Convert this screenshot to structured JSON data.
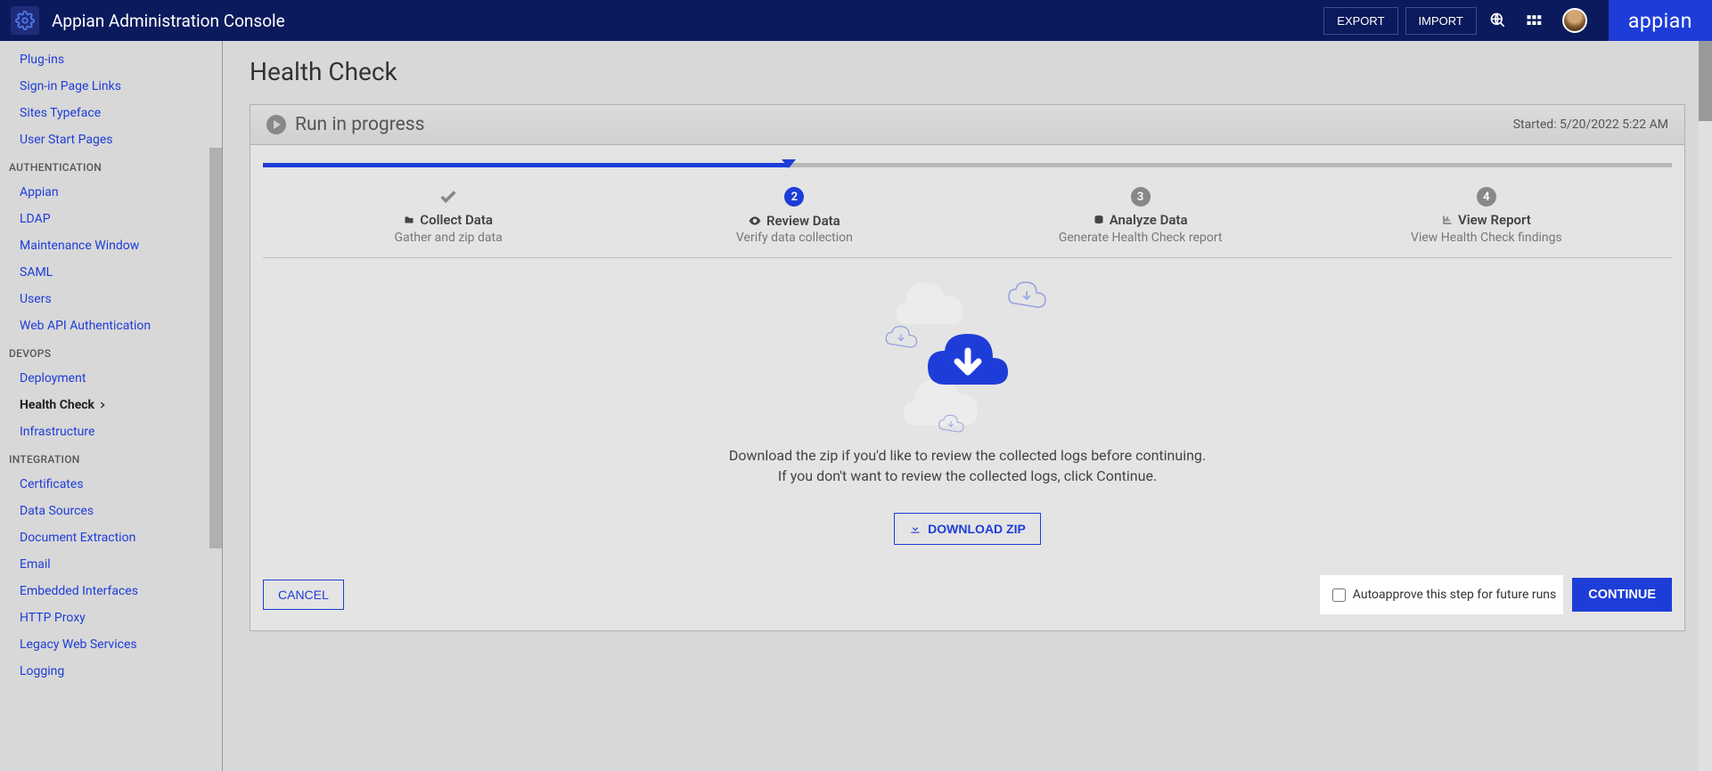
{
  "header": {
    "title": "Appian Administration Console",
    "export": "EXPORT",
    "import": "IMPORT",
    "brand": "appian"
  },
  "sidebar": {
    "top_links": [
      {
        "label": "Plug-ins"
      },
      {
        "label": "Sign-in Page Links"
      },
      {
        "label": "Sites Typeface"
      },
      {
        "label": "User Start Pages"
      }
    ],
    "sections": [
      {
        "heading": "AUTHENTICATION",
        "items": [
          {
            "label": "Appian"
          },
          {
            "label": "LDAP"
          },
          {
            "label": "Maintenance Window"
          },
          {
            "label": "SAML"
          },
          {
            "label": "Users"
          },
          {
            "label": "Web API Authentication"
          }
        ]
      },
      {
        "heading": "DEVOPS",
        "items": [
          {
            "label": "Deployment"
          },
          {
            "label": "Health Check",
            "active": true
          },
          {
            "label": "Infrastructure"
          }
        ]
      },
      {
        "heading": "INTEGRATION",
        "items": [
          {
            "label": "Certificates"
          },
          {
            "label": "Data Sources"
          },
          {
            "label": "Document Extraction"
          },
          {
            "label": "Email"
          },
          {
            "label": "Embedded Interfaces"
          },
          {
            "label": "HTTP Proxy"
          },
          {
            "label": "Legacy Web Services"
          },
          {
            "label": "Logging"
          }
        ]
      }
    ]
  },
  "page": {
    "title": "Health Check",
    "card_title": "Run in progress",
    "started_label": "Started: 5/20/2022 5:22 AM",
    "steps": [
      {
        "title": "Collect Data",
        "sub": "Gather and zip data",
        "state": "done"
      },
      {
        "title": "Review Data",
        "sub": "Verify data collection",
        "state": "active",
        "num": "2"
      },
      {
        "title": "Analyze Data",
        "sub": "Generate Health Check report",
        "state": "pending",
        "num": "3"
      },
      {
        "title": "View Report",
        "sub": "View Health Check findings",
        "state": "pending",
        "num": "4"
      }
    ],
    "body_line1": "Download the zip if you'd like to review the collected logs before continuing.",
    "body_line2": "If you don't want to review the collected logs, click Continue.",
    "download": "DOWNLOAD ZIP",
    "cancel": "CANCEL",
    "autoapprove": "Autoapprove this step for future runs",
    "continue": "CONTINUE"
  }
}
